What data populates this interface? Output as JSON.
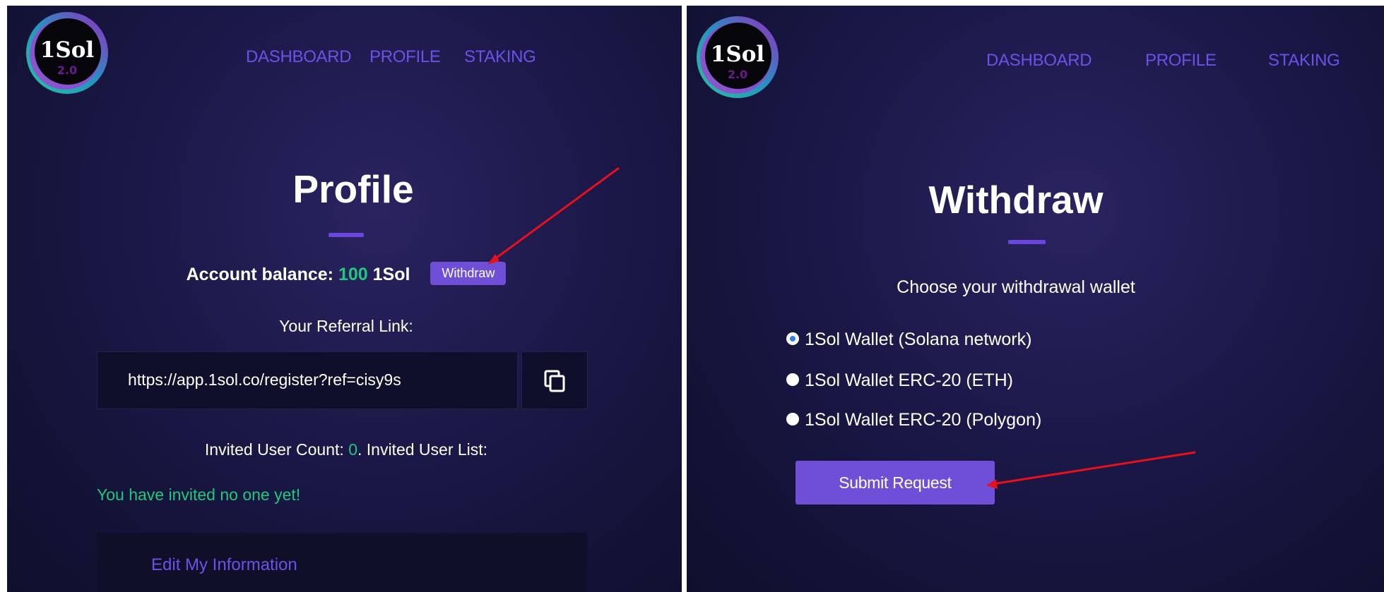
{
  "logo": {
    "text": "1Sol",
    "subtext": "2.0"
  },
  "nav": {
    "dashboard": "DASHBOARD",
    "profile": "PROFILE",
    "staking": "STAKING"
  },
  "profile": {
    "title": "Profile",
    "balance_label": "Account balance:",
    "balance_value": "100",
    "balance_unit": "1Sol",
    "withdraw_label": "Withdraw",
    "referral_label": "Your Referral Link:",
    "referral_url": "https://app.1sol.co/register?ref=cisy9s",
    "invited_label": "Invited User Count:",
    "invited_count": "0",
    "invited_list_label": ". Invited User List:",
    "invite_empty": "You have invited no one yet!",
    "edit_label": "Edit My Information"
  },
  "withdraw": {
    "title": "Withdraw",
    "choose_label": "Choose your withdrawal wallet",
    "options": [
      {
        "label": "1Sol Wallet (Solana network)",
        "checked": true
      },
      {
        "label": "1Sol Wallet ERC-20 (ETH)",
        "checked": false
      },
      {
        "label": "1Sol Wallet ERC-20 (Polygon)",
        "checked": false
      }
    ],
    "submit_label": "Submit Request"
  },
  "colors": {
    "accent": "#6f4fd8",
    "nav_link": "#6a52e8",
    "positive": "#1fc97c",
    "annotation_arrow": "#e8101a"
  },
  "icons": {
    "copy": "copy-icon",
    "radio_selected": "radio-selected-icon",
    "radio_unselected": "radio-unselected-icon"
  }
}
